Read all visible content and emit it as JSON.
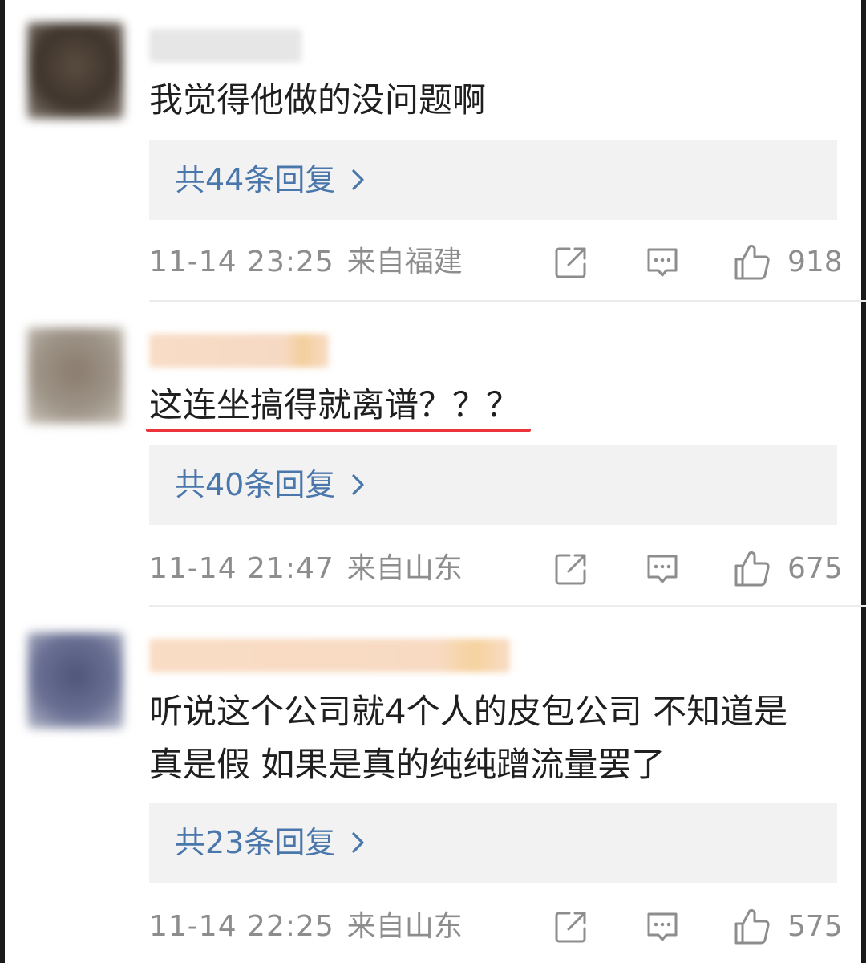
{
  "comments": [
    {
      "text": "我觉得他做的没问题啊",
      "reply_label": "共44条回复",
      "time": "11-14 23:25",
      "location": "来自福建",
      "likes": "918",
      "avatar_color": "#4a3f36",
      "name_color": "#e4e4e4"
    },
    {
      "text": "这连坐搞得就离谱？？？",
      "reply_label": "共40条回复",
      "time": "11-14 21:47",
      "location": "来自山东",
      "likes": "675",
      "avatar_color": "#8e8478",
      "name_color": "#f7dcc4"
    },
    {
      "text_line1": "听说这个公司就4个人的皮包公司 不知道是",
      "text_line2": "真是假 如果是真的纯纯蹭流量罢了",
      "reply_label": "共23条回复",
      "time": "11-14 22:25",
      "location": "来自山东",
      "likes": "575",
      "avatar_color": "#5e6688",
      "name_color": "#f8dcc2"
    }
  ],
  "icons": [
    "share-icon",
    "comment-icon",
    "thumbs-up-icon",
    "chevron-right-icon"
  ],
  "colors": {
    "link": "#4a77ab",
    "meta": "#8d8d8d",
    "text": "#1f1f1f",
    "reply_bg": "#f2f2f2",
    "highlight_underline": "#e8343a"
  }
}
